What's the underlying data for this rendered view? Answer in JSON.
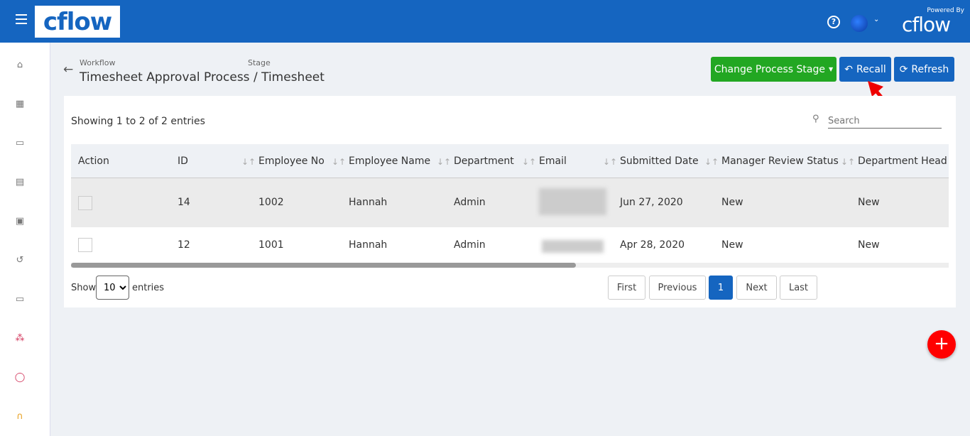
{
  "header": {
    "logo": "cflow",
    "powered_by": "Powered By",
    "powered_logo": "cflow",
    "help_icon": "question-circle-icon"
  },
  "sidebar": {
    "items": [
      "home",
      "dashboard",
      "calendar",
      "reports",
      "documents",
      "history",
      "forms",
      "workflow",
      "target",
      "support"
    ]
  },
  "page": {
    "workflow_label": "Workflow",
    "stage_label": "Stage",
    "workflow": "Timesheet Approval Process",
    "sep": "/",
    "stage": "Timesheet"
  },
  "toolbar": {
    "change_stage": "Change Process Stage",
    "recall": "Recall",
    "refresh": "Refresh",
    "accent_green": "#22a722",
    "accent_blue": "#1565c0"
  },
  "table": {
    "showing": "Showing 1 to 2 of 2 entries",
    "search_placeholder": "Search",
    "columns": [
      "Action",
      "ID",
      "Employee No",
      "Employee Name",
      "Department",
      "Email",
      "Submitted Date",
      "Manager Review Status",
      "Department Head R"
    ],
    "rows": [
      {
        "id": "14",
        "emp_no": "1002",
        "name": "Hannah",
        "dept": "Admin",
        "submitted": "Jun 27, 2020",
        "mgr": "New",
        "head": "New"
      },
      {
        "id": "12",
        "emp_no": "1001",
        "name": "Hannah",
        "dept": "Admin",
        "submitted": "Apr 28, 2020",
        "mgr": "New",
        "head": "New"
      }
    ]
  },
  "footer": {
    "show": "Show",
    "page_size": "10",
    "entries": "entries",
    "first": "First",
    "previous": "Previous",
    "current": "1",
    "next": "Next",
    "last": "Last"
  },
  "fab": "+"
}
